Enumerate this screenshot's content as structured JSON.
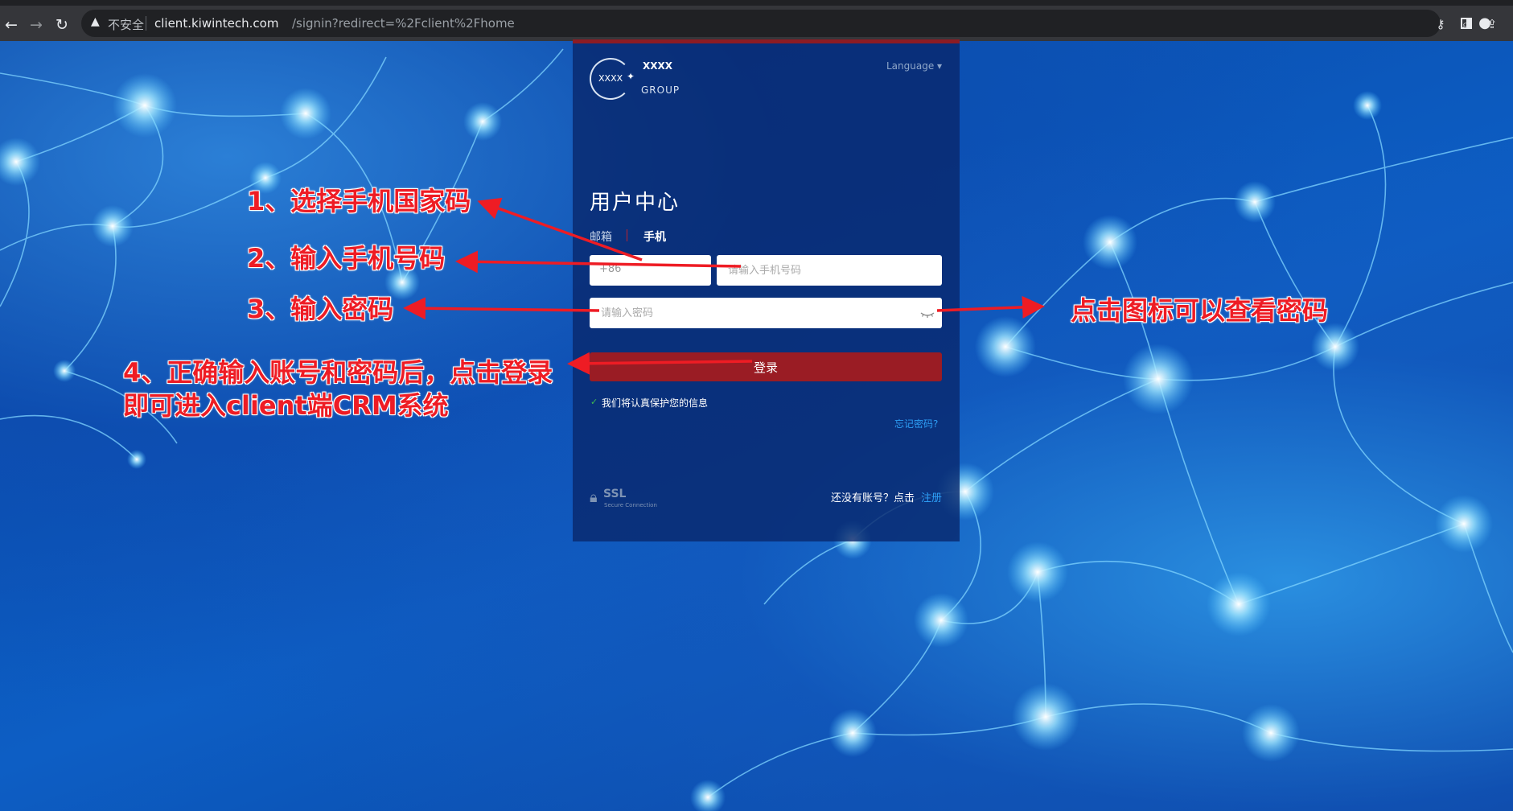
{
  "browser": {
    "insecure_label": "不安全",
    "url_host": "client.kiwintech.com",
    "url_path": "/signin?redirect=%2Fclient%2Fhome"
  },
  "card": {
    "logo_circle_text": "XXXX",
    "logo_name": "XXXX",
    "logo_group": "GROUP",
    "language_label": "Language ▾",
    "title": "用户中心",
    "tab_email": "邮箱",
    "tab_phone": "手机",
    "country_code": "+86",
    "phone_placeholder": "请输入手机号码",
    "password_placeholder": "请输入密码",
    "login_label": "登录",
    "privacy_check": "✓",
    "privacy_text": "我们将认真保护您的信息",
    "forgot_label": "忘记密码?",
    "ssl_big": "SSL",
    "ssl_small": "Secure Connection",
    "signup_prompt": "还没有账号？点击",
    "signup_link": "注册"
  },
  "annotations": {
    "step1": "1、选择手机国家码",
    "step2": "2、输入手机号码",
    "step3": "3、输入密码",
    "step4_line1": "4、正确输入账号和密码后，点击登录",
    "step4_line2": "即可进入client端CRM系统",
    "eye_hint": "点击图标可以查看密码"
  },
  "colors": {
    "accent_red": "#9a1c24",
    "annotation_red": "#ee1c24",
    "link_blue": "#2d9ef5"
  },
  "icons": [
    "back-icon",
    "forward-icon",
    "reload-icon",
    "warning-icon",
    "key-icon",
    "zoom-icon",
    "share-icon",
    "star-icon",
    "side-panel-icon",
    "profile-icon",
    "eye-icon",
    "lock-icon"
  ]
}
